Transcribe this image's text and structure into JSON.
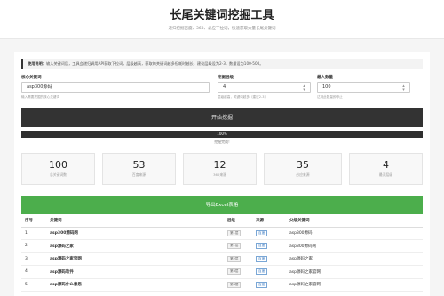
{
  "header": {
    "title": "长尾关键词挖掘工具",
    "subtitle": "递归挖掘百度、360、必应下拉词，快速获取大量长尾关键词"
  },
  "notice": {
    "label": "使用说明：",
    "text": "输入关键词后，工具会递归调用API获取下拉词，层级越高，获取的关键词越多但耗时越长，建议层级设为2-3，数量设为100-500。"
  },
  "form": {
    "keyword_label": "核心关键词",
    "keyword_value": "asp300源码",
    "keyword_help": "输入需要挖掘的核心关键词",
    "level_label": "挖掘层级",
    "level_value": "4",
    "level_help": "层级越高，关键词越多（建议2-3）",
    "max_label": "最大数量",
    "max_value": "100",
    "max_help": "达到此数量即停止"
  },
  "actions": {
    "start_label": "开始挖掘",
    "export_label": "导出Excel表格"
  },
  "progress": {
    "percent": 100,
    "text": "100%",
    "status": "挖掘完成!"
  },
  "stats": [
    {
      "value": "100",
      "label": "总关键词数"
    },
    {
      "value": "53",
      "label": "百度来源"
    },
    {
      "value": "12",
      "label": "360来源"
    },
    {
      "value": "35",
      "label": "必应来源"
    },
    {
      "value": "4",
      "label": "最深层级"
    }
  ],
  "table": {
    "headers": [
      "序号",
      "关键词",
      "层级",
      "来源",
      "父级关键词"
    ],
    "rows": [
      {
        "index": "1",
        "keyword": "asp300源码网",
        "level": "第1层",
        "source": "百度",
        "parent": "asp300源码"
      },
      {
        "index": "2",
        "keyword": "asp源码之家",
        "level": "第1层",
        "source": "百度",
        "parent": "asp300源码网"
      },
      {
        "index": "3",
        "keyword": "asp源码之家官网",
        "level": "第2层",
        "source": "百度",
        "parent": "asp源码之家"
      },
      {
        "index": "4",
        "keyword": "asp源码软件",
        "level": "第3层",
        "source": "百度",
        "parent": "asp源码之家官网"
      },
      {
        "index": "5",
        "keyword": "asp源码什么意思",
        "level": "第4层",
        "source": "百度",
        "parent": "asp源码之家官网"
      }
    ]
  },
  "colors": {
    "dark": "#333333",
    "success": "#4cae4c",
    "source_badge": "#3a79c0"
  }
}
